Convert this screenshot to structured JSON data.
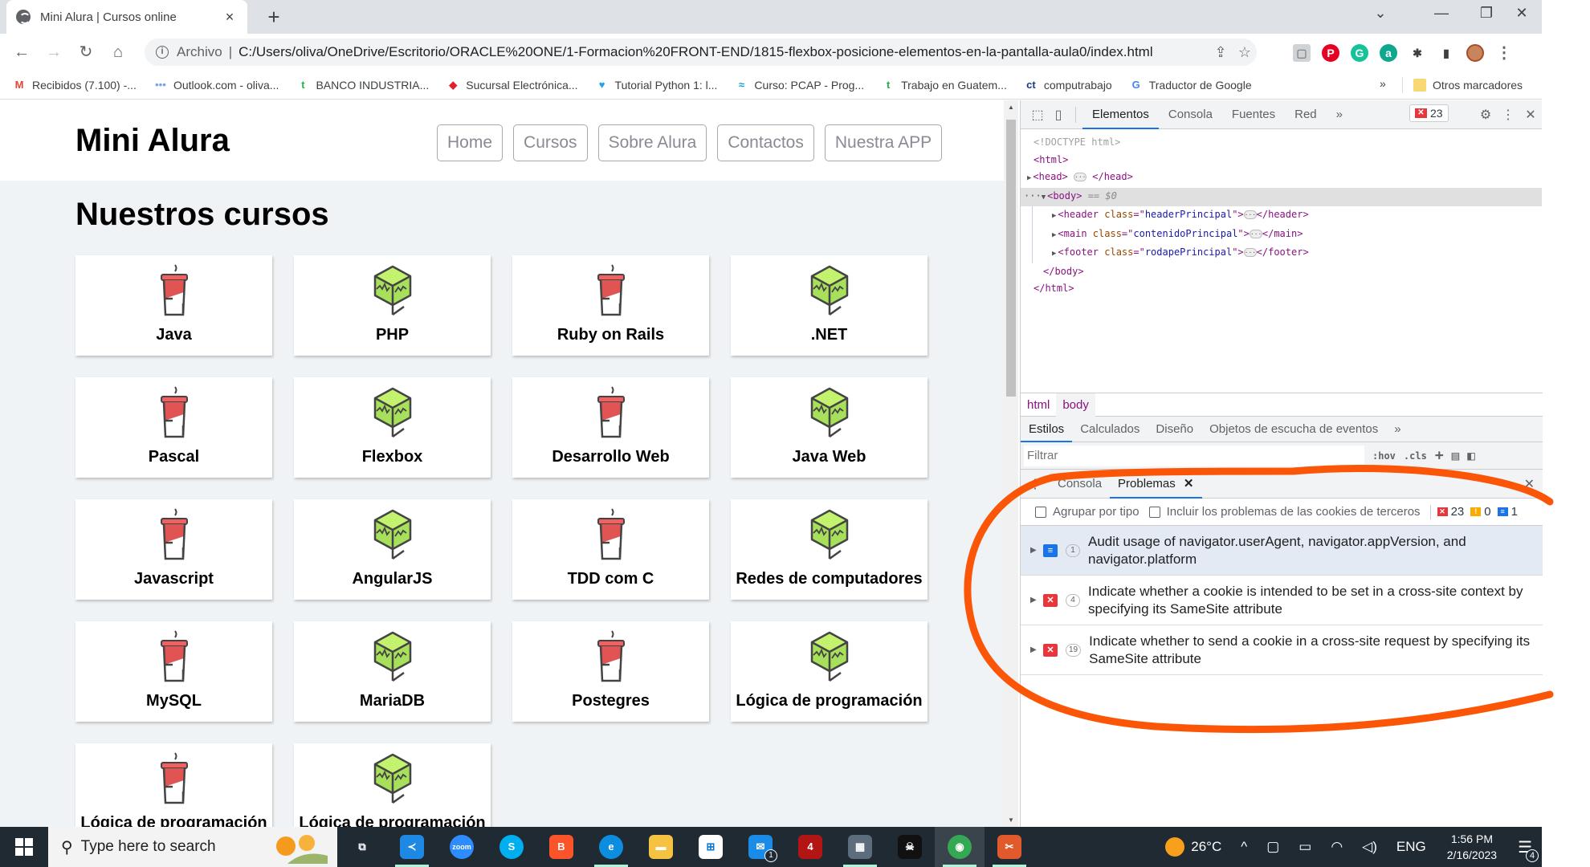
{
  "browser": {
    "tab_title": "Mini Alura | Cursos online",
    "tab_close": "×",
    "new_tab": "+",
    "window_controls": {
      "tab_search": "⌄",
      "minimize": "—",
      "restore": "❐",
      "close": "✕"
    },
    "nav": {
      "back": "←",
      "forward": "→",
      "reload": "↻",
      "home": "⌂"
    },
    "omnibox": {
      "info_icon": "i",
      "scheme_label": "Archivo",
      "separator": "|",
      "url": "C:/Users/oliva/OneDrive/Escritorio/ORACLE%20ONE/1-Formacion%20FRONT-END/1815-flexbox-posicione-elementos-en-la-pantalla-aula0/index.html",
      "share_icon": "⇪",
      "star_icon": "☆"
    },
    "extensions": [
      {
        "name": "reader-mode-icon",
        "glyph": "▢",
        "color": "#d0d3d6"
      },
      {
        "name": "pinterest-icon",
        "glyph": "P",
        "color": "#e60023"
      },
      {
        "name": "grammarly-icon",
        "glyph": "G",
        "color": "#15c39a"
      },
      {
        "name": "extension-a-icon",
        "glyph": "a",
        "color": "#0fa88f"
      },
      {
        "name": "puzzle-icon",
        "glyph": "✱",
        "color": "#3c4043"
      },
      {
        "name": "side-panel-icon",
        "glyph": "▮",
        "color": "#3c4043"
      }
    ],
    "menu_icon": "⋮",
    "bookmarks": [
      {
        "label": "Recibidos (7.100) -...",
        "icon": "M",
        "color": "#ea4335"
      },
      {
        "label": "Outlook.com - oliva...",
        "icon": "•••",
        "color": "#7aa6e0"
      },
      {
        "label": "BANCO INDUSTRIA...",
        "icon": "t",
        "color": "#22b14c"
      },
      {
        "label": "Sucursal Electrónica...",
        "icon": "◆",
        "color": "#e0202a"
      },
      {
        "label": "Tutorial Python 1: l...",
        "icon": "♥",
        "color": "#1da1f2"
      },
      {
        "label": "Curso: PCAP - Prog...",
        "icon": "≈",
        "color": "#049fd9"
      },
      {
        "label": "Trabajo en Guatem...",
        "icon": "t",
        "color": "#22b14c"
      },
      {
        "label": "computrabajo",
        "icon": "ct",
        "color": "#1a3a8a"
      },
      {
        "label": "Traductor de Google",
        "icon": "G",
        "color": "#4285f4"
      }
    ],
    "bookmarks_more": "»",
    "other_bookmarks": "Otros marcadores"
  },
  "page": {
    "logo": "Mini Alura",
    "menu": [
      "Home",
      "Cursos",
      "Sobre Alura",
      "Contactos",
      "Nuestra APP"
    ],
    "section_title": "Nuestros cursos",
    "courses": [
      {
        "name": "Java",
        "icon": "cup"
      },
      {
        "name": "PHP",
        "icon": "cube"
      },
      {
        "name": "Ruby on Rails",
        "icon": "cup"
      },
      {
        "name": ".NET",
        "icon": "cube"
      },
      {
        "name": "Pascal",
        "icon": "cup"
      },
      {
        "name": "Flexbox",
        "icon": "cube"
      },
      {
        "name": "Desarrollo Web",
        "icon": "cup"
      },
      {
        "name": "Java Web",
        "icon": "cube"
      },
      {
        "name": "Javascript",
        "icon": "cup"
      },
      {
        "name": "AngularJS",
        "icon": "cube"
      },
      {
        "name": "TDD com C",
        "icon": "cup"
      },
      {
        "name": "Redes de computadores",
        "icon": "cube"
      },
      {
        "name": "MySQL",
        "icon": "cup"
      },
      {
        "name": "MariaDB",
        "icon": "cube"
      },
      {
        "name": "Postegres",
        "icon": "cup"
      },
      {
        "name": "Lógica de programación",
        "icon": "cube"
      },
      {
        "name": "Lógica de programación",
        "icon": "cup"
      },
      {
        "name": "Lógica de programación",
        "icon": "cube"
      }
    ]
  },
  "devtools": {
    "tabs": [
      "Elementos",
      "Consola",
      "Fuentes",
      "Red"
    ],
    "active_tab": "Elementos",
    "more_tabs": "»",
    "error_count": "23",
    "dom": {
      "doctype": "<!DOCTYPE html>",
      "html_open": "<html>",
      "head": {
        "open": "<head>",
        "close": "</head>"
      },
      "body_open": "<body>",
      "body_marker": "== $0",
      "children": [
        {
          "tag": "header",
          "attr": "class",
          "value": "headerPrincipal"
        },
        {
          "tag": "main",
          "attr": "class",
          "value": "contenidoPrincipal"
        },
        {
          "tag": "footer",
          "attr": "class",
          "value": "rodapePrincipal"
        }
      ],
      "body_close": "</body>",
      "html_close": "</html>"
    },
    "breadcrumbs": [
      "html",
      "body"
    ],
    "styles_tabs": [
      "Estilos",
      "Calculados",
      "Diseño",
      "Objetos de escucha de eventos"
    ],
    "filter_placeholder": "Filtrar",
    "filter_tools": [
      ":hov",
      ".cls",
      "+"
    ],
    "drawer_tabs": [
      "Consola",
      "Problemas"
    ],
    "drawer_active": "Problemas",
    "problems_options": {
      "group_by_type": "Agrupar por tipo",
      "include_third_party": "Incluir los problemas de las cookies de terceros"
    },
    "problem_counts": {
      "errors": "23",
      "warnings": "0",
      "info": "1"
    },
    "issues": [
      {
        "kind": "info",
        "count": "1",
        "text": "Audit usage of navigator.userAgent, navigator.appVersion, and navigator.platform"
      },
      {
        "kind": "error",
        "count": "4",
        "text": "Indicate whether a cookie is intended to be set in a cross-site context by specifying its SameSite attribute"
      },
      {
        "kind": "error",
        "count": "19",
        "text": "Indicate whether to send a cookie in a cross-site request by specifying its SameSite attribute"
      }
    ],
    "colors": {
      "error": "#e8363a",
      "warning": "#f9ab00",
      "info": "#1a73e8",
      "annotation": "#fb5607"
    }
  },
  "taskbar": {
    "search_placeholder": "Type here to search",
    "apps": [
      {
        "name": "task-view",
        "glyph": "⧉",
        "color": "transparent",
        "running": false
      },
      {
        "name": "vscode",
        "glyph": "≺",
        "color": "#1e88e5",
        "running": true
      },
      {
        "name": "zoom",
        "glyph": "zoom",
        "color": "#2d8cff",
        "running": false
      },
      {
        "name": "skype",
        "glyph": "S",
        "color": "#00aff0",
        "running": false
      },
      {
        "name": "brave",
        "glyph": "B",
        "color": "#fb542b",
        "running": false
      },
      {
        "name": "edge",
        "glyph": "e",
        "color": "#0c8de0",
        "running": true
      },
      {
        "name": "file-explorer",
        "glyph": "▬",
        "color": "#f5c242",
        "running": false
      },
      {
        "name": "store",
        "glyph": "⊞",
        "color": "#ffffff",
        "running": false
      },
      {
        "name": "mail",
        "glyph": "✉",
        "color": "#1a8ce8",
        "running": false,
        "badge": "1"
      },
      {
        "name": "game-4",
        "glyph": "4",
        "color": "#b31515",
        "running": false
      },
      {
        "name": "calculator",
        "glyph": "▦",
        "color": "#5d6d7e",
        "running": true
      },
      {
        "name": "game-dark",
        "glyph": "☠",
        "color": "#111111",
        "running": false
      },
      {
        "name": "chrome",
        "glyph": "◉",
        "color": "#34a853",
        "running": true,
        "active": true
      },
      {
        "name": "snipping-tool",
        "glyph": "✂",
        "color": "#e05a2b",
        "running": true
      }
    ],
    "weather": "26°C",
    "language": "ENG",
    "time": "1:56 PM",
    "date": "2/16/2023",
    "notifications": "4"
  }
}
